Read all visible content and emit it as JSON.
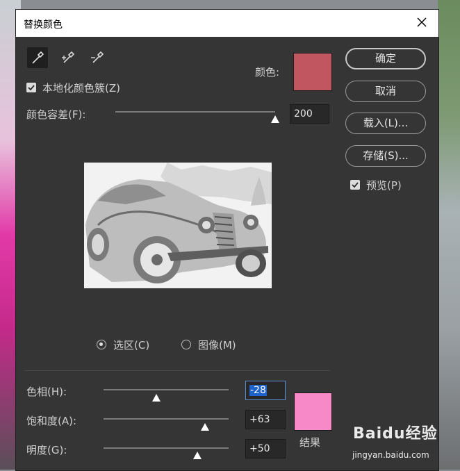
{
  "window": {
    "title": "替换颜色"
  },
  "top": {
    "color_label": "颜色:",
    "color_hex": "#c25660",
    "localized_label": "本地化颜色簇(Z)",
    "localized_checked": true,
    "fuzziness_label": "颜色容差(F):",
    "fuzziness_value": "200",
    "fuzziness_level": 1.0
  },
  "buttons": {
    "ok": "确定",
    "cancel": "取消",
    "load": "载入(L)...",
    "save": "存储(S)..."
  },
  "preview_option": {
    "label": "预览(P)",
    "checked": true
  },
  "view": {
    "selection_label": "选区(C)",
    "image_label": "图像(M)",
    "selected": "selection"
  },
  "replacement": {
    "hue_label": "色相(H):",
    "hue_value": "-28",
    "hue_level": 0.42,
    "saturation_label": "饱和度(A):",
    "saturation_value": "+63",
    "saturation_level": 0.81,
    "lightness_label": "明度(G):",
    "lightness_value": "+50",
    "lightness_level": 0.75,
    "result_label": "结果",
    "result_hex": "#f889c8"
  },
  "watermark": {
    "brand": "Baidu经验",
    "url": "jingyan.baidu.com"
  },
  "icons": [
    "close-icon",
    "eyedropper-icon",
    "eyedropper-plus-icon",
    "eyedropper-minus-icon",
    "checkmark-icon"
  ]
}
